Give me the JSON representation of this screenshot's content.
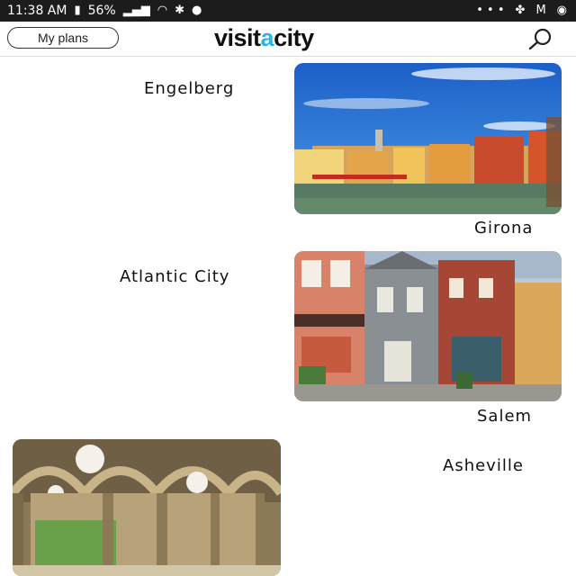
{
  "status_bar": {
    "time": "11:38 AM",
    "battery": "56%",
    "icons": [
      "battery-icon",
      "signal-icon",
      "wifi-icon",
      "bluetooth-icon",
      "location-icon",
      "more-icon",
      "fan-icon",
      "mail-icon",
      "alarm-icon"
    ]
  },
  "header": {
    "my_plans_label": "My plans",
    "logo_prefix": "visit",
    "logo_accent": "a",
    "logo_suffix": "city",
    "accent_color": "#29b6e6"
  },
  "cities": [
    {
      "name": "Engelberg"
    },
    {
      "name": "Girona"
    },
    {
      "name": "Atlantic City"
    },
    {
      "name": "Salem"
    },
    {
      "name": "Asheville"
    }
  ]
}
